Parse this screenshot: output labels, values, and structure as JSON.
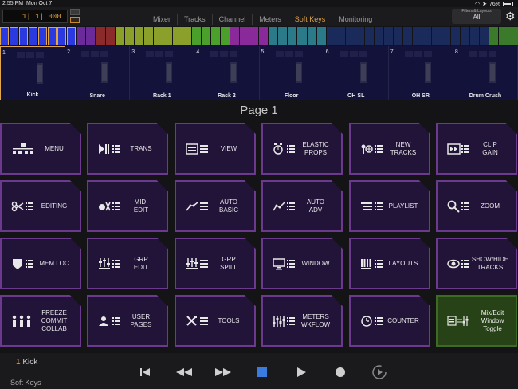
{
  "status": {
    "time": "2:55 PM",
    "date": "Mon Oct 7",
    "battery": "76%"
  },
  "header": {
    "counter": "1|  1|  000",
    "tabs": [
      "Mixer",
      "Tracks",
      "Channel",
      "Meters",
      "Soft Keys",
      "Monitoring"
    ],
    "active_tab": "Soft Keys",
    "filters_label": "Filters & Layouts",
    "filters_value": "All"
  },
  "strip_colors": [
    "#2a3ae0",
    "#2a3ae0",
    "#2a3ae0",
    "#2a3ae0",
    "#2a3ae0",
    "#2a3ae0",
    "#2a3ae0",
    "#2a3ae0",
    "#6a2a9a",
    "#6a2a9a",
    "#8a2a2a",
    "#8a2a2a",
    "#8aa02a",
    "#8aa02a",
    "#8aa02a",
    "#8aa02a",
    "#8aa02a",
    "#8aa02a",
    "#8aa02a",
    "#8aa02a",
    "#4aa02a",
    "#4aa02a",
    "#4aa02a",
    "#4aa02a",
    "#8a2a9a",
    "#8a2a9a",
    "#8a2a9a",
    "#8a2a9a",
    "#2a7a8a",
    "#2a7a8a",
    "#2a7a8a",
    "#2a7a8a",
    "#2a7a8a",
    "#2a7a8a",
    "#1a2a5a",
    "#1a2a5a",
    "#1a2a5a",
    "#1a2a5a",
    "#1a2a5a",
    "#1a2a5a",
    "#1a2a5a",
    "#1a2a5a",
    "#1a2a5a",
    "#1a2a5a",
    "#1a2a5a",
    "#1a2a5a",
    "#1a2a5a",
    "#1a2a5a",
    "#1a2a5a",
    "#1a2a5a",
    "#1a2a5a",
    "#3a7a2a",
    "#3a7a2a",
    "#3a7a2a"
  ],
  "tracks": [
    {
      "num": "1",
      "name": "Kick",
      "selected": true
    },
    {
      "num": "2",
      "name": "Snare"
    },
    {
      "num": "3",
      "name": "Rack 1"
    },
    {
      "num": "4",
      "name": "Rack 2"
    },
    {
      "num": "5",
      "name": "Floor"
    },
    {
      "num": "6",
      "name": "OH SL"
    },
    {
      "num": "7",
      "name": "OH SR"
    },
    {
      "num": "8",
      "name": "Drum Crush"
    }
  ],
  "page_title": "Page 1",
  "soft_keys": [
    {
      "label": "MENU",
      "icon": "menu-tree-icon"
    },
    {
      "label": "TRANS",
      "icon": "play-pause-icon"
    },
    {
      "label": "VIEW",
      "icon": "view-icon"
    },
    {
      "label": "ELASTIC\nPROPS",
      "icon": "elastic-clock-icon"
    },
    {
      "label": "NEW\nTRACKS",
      "icon": "new-tracks-icon"
    },
    {
      "label": "CLIP\nGAIN",
      "icon": "clip-gain-icon"
    },
    {
      "label": "EDITING",
      "icon": "scissors-icon"
    },
    {
      "label": "MIDI\nEDIT",
      "icon": "midi-edit-icon"
    },
    {
      "label": "AUTO\nBASIC",
      "icon": "automation-icon"
    },
    {
      "label": "AUTO\nADV",
      "icon": "automation-adv-icon"
    },
    {
      "label": "PLAYLIST",
      "icon": "playlist-icon"
    },
    {
      "label": "ZOOM",
      "icon": "zoom-icon"
    },
    {
      "label": "MEM LOC",
      "icon": "marker-icon"
    },
    {
      "label": "GRP\nEDIT",
      "icon": "group-edit-icon"
    },
    {
      "label": "GRP\nSPILL",
      "icon": "group-spill-icon"
    },
    {
      "label": "WINDOW",
      "icon": "monitor-icon"
    },
    {
      "label": "LAYOUTS",
      "icon": "layouts-icon"
    },
    {
      "label": "SHOW/HIDE\nTRACKS",
      "icon": "eye-icon"
    },
    {
      "label": "FREEZE\nCOMMIT\nCOLLAB",
      "icon": "people-icon"
    },
    {
      "label": "USER\nPAGES",
      "icon": "user-icon"
    },
    {
      "label": "TOOLS",
      "icon": "tools-icon"
    },
    {
      "label": "METERS\nWKFLOW",
      "icon": "meters-icon"
    },
    {
      "label": "COUNTER",
      "icon": "clock-icon"
    },
    {
      "label": "Mix/Edit\nWindow\nToggle",
      "icon": "window-toggle-icon",
      "green": true
    }
  ],
  "footer": {
    "selected_num": "1",
    "selected_name": "Kick",
    "mode": "Soft Keys"
  },
  "colors": {
    "accent": "#e0a648",
    "key_border": "#6b3a8f",
    "key_bg": "#221338",
    "green_key": "#284218"
  }
}
